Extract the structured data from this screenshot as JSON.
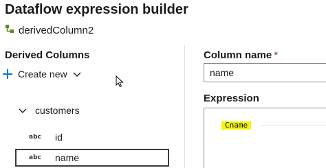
{
  "window": {
    "title": "Dataflow expression builder",
    "subtitle": "derivedColumn2"
  },
  "left_panel": {
    "heading": "Derived Columns",
    "create_new_label": "Create new",
    "group": {
      "label": "customers",
      "columns": [
        {
          "type": "abc",
          "name": "id"
        },
        {
          "type": "abc",
          "name": "name"
        }
      ]
    }
  },
  "right_panel": {
    "column_name_label": "Column name",
    "required_marker": "*",
    "column_name_value": "name",
    "expression_label": "Expression",
    "expression_value": "Cname"
  },
  "colors": {
    "accent": "#0078d4",
    "required": "#a4262c",
    "expression_highlight": "#f4f40a",
    "dataflow_icon": "#5b8a1e"
  }
}
